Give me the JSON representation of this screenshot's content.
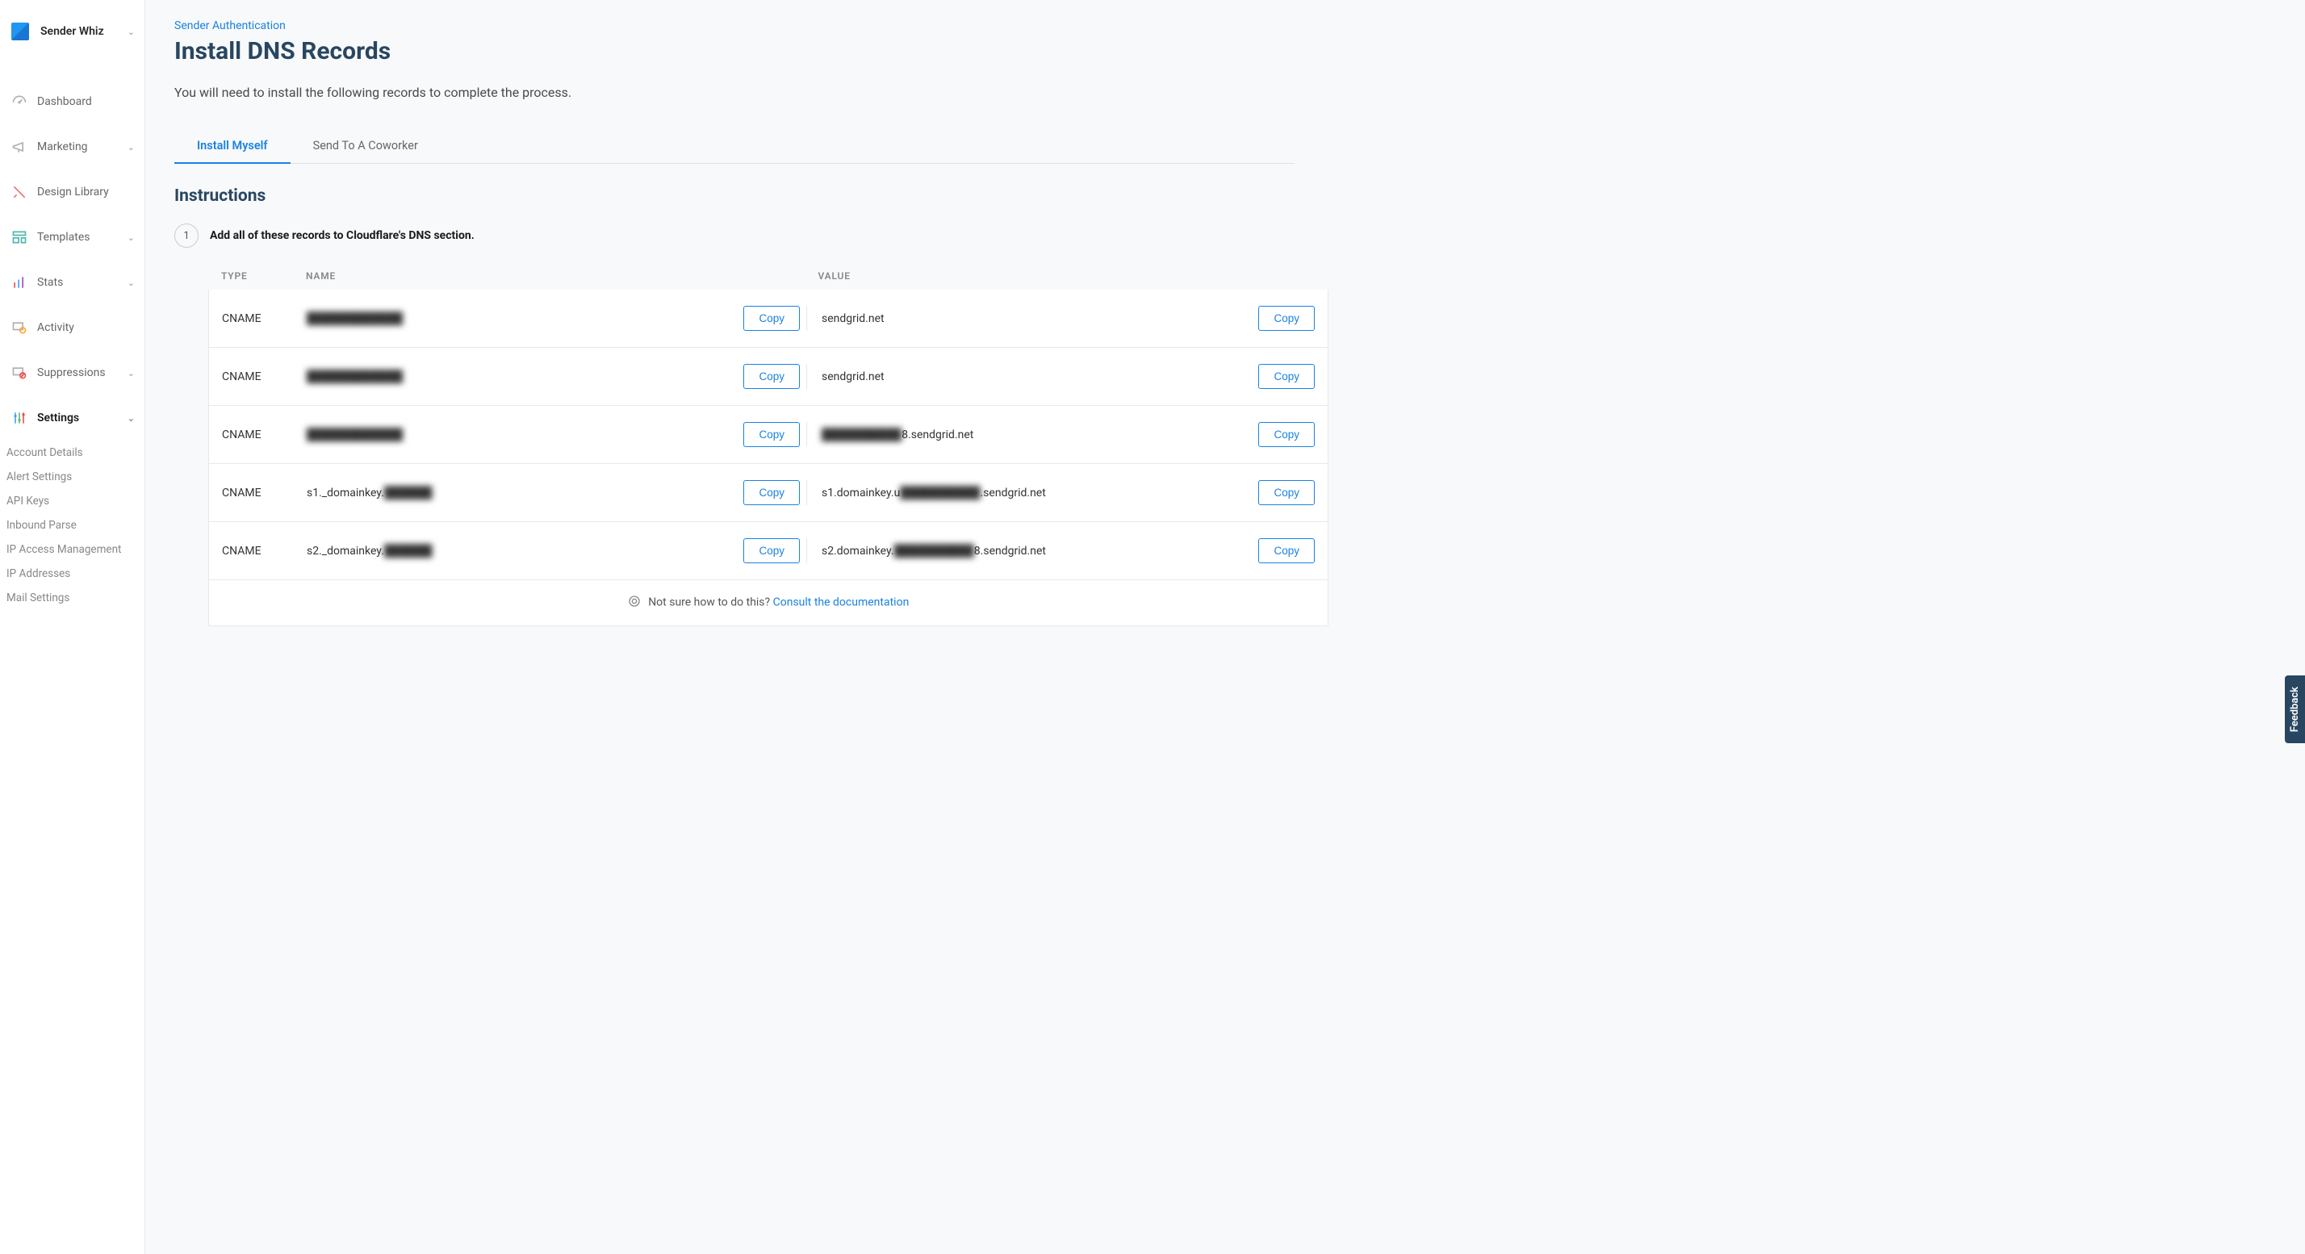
{
  "org": {
    "name": "Sender Whiz"
  },
  "sidebar": {
    "items": [
      {
        "label": "Dashboard"
      },
      {
        "label": "Marketing"
      },
      {
        "label": "Design Library"
      },
      {
        "label": "Templates"
      },
      {
        "label": "Stats"
      },
      {
        "label": "Activity"
      },
      {
        "label": "Suppressions"
      },
      {
        "label": "Settings"
      }
    ],
    "submenu": [
      {
        "label": "Account Details"
      },
      {
        "label": "Alert Settings"
      },
      {
        "label": "API Keys"
      },
      {
        "label": "Inbound Parse"
      },
      {
        "label": "IP Access Management"
      },
      {
        "label": "IP Addresses"
      },
      {
        "label": "Mail Settings"
      }
    ]
  },
  "page": {
    "breadcrumb": "Sender Authentication",
    "title": "Install DNS Records",
    "intro": "You will need to install the following records to complete the process.",
    "tabs": [
      {
        "label": "Install Myself"
      },
      {
        "label": "Send To A Coworker"
      }
    ],
    "instructions_heading": "Instructions",
    "step_number": "1",
    "step_text": "Add all of these records to Cloudflare's DNS section.",
    "columns": {
      "type": "TYPE",
      "name": "NAME",
      "value": "VALUE"
    },
    "copy_label": "Copy",
    "rows": [
      {
        "type": "CNAME",
        "name": "████████████",
        "name_blurred": true,
        "value": "sendgrid.net",
        "value_blurred": false
      },
      {
        "type": "CNAME",
        "name": "████████████",
        "name_blurred": true,
        "value": "sendgrid.net",
        "value_blurred": false
      },
      {
        "type": "CNAME",
        "name": "████████████",
        "name_blurred": true,
        "value": "██████████8.sendgrid.net",
        "value_blurred": false,
        "value_prefix_blurred": true
      },
      {
        "type": "CNAME",
        "name_prefix": "s1._domainkey.",
        "name_suffix": "██████",
        "name_blurred": false,
        "value_prefix": "s1.domainkey.u",
        "value_mid": "██████████",
        "value_suffix": ".sendgrid.net",
        "value_blurred": false
      },
      {
        "type": "CNAME",
        "name_prefix": "s2._domainkey.",
        "name_suffix": "██████",
        "name_blurred": false,
        "value_prefix": "s2.domainkey.",
        "value_mid": "██████████",
        "value_suffix": "8.sendgrid.net",
        "value_blurred": false
      }
    ],
    "help_text": "Not sure how to do this? ",
    "help_link": "Consult the documentation"
  },
  "feedback_label": "Feedback"
}
